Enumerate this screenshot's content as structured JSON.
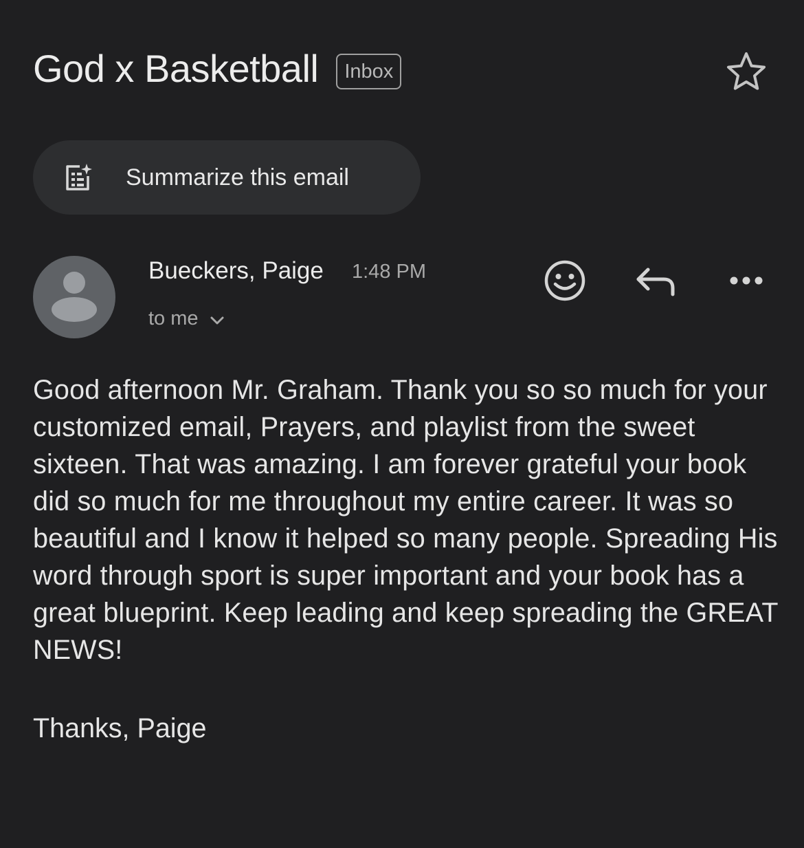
{
  "email": {
    "subject": "God x Basketball",
    "label": "Inbox",
    "summarize_label": "Summarize this email",
    "sender": "Bueckers, Paige",
    "time": "1:48 PM",
    "recipients": "to me",
    "body": "Good afternoon Mr. Graham. Thank you so so much for your customized email, Prayers, and playlist from the sweet sixteen. That was amazing. I am forever grateful your book did so much for me throughout my entire career. It was so beautiful and I know it helped so many people. Spreading His word through sport is super important and your book has a great blueprint. Keep leading and keep spreading the GREAT NEWS!",
    "signoff": "Thanks, Paige"
  },
  "icons": {
    "star": "star-outline-icon",
    "summarize": "summarize-sparkle-icon",
    "avatar": "person-avatar-icon",
    "emoji": "emoji-reaction-icon",
    "reply": "reply-icon",
    "more": "more-horizontal-icon",
    "expand": "chevron-down-icon"
  },
  "colors": {
    "background": "#1f1f21",
    "chip": "#2d2e30",
    "primary_text": "#e6e6e6",
    "secondary_text": "#a9a9a9",
    "avatar": "#5f6266"
  }
}
